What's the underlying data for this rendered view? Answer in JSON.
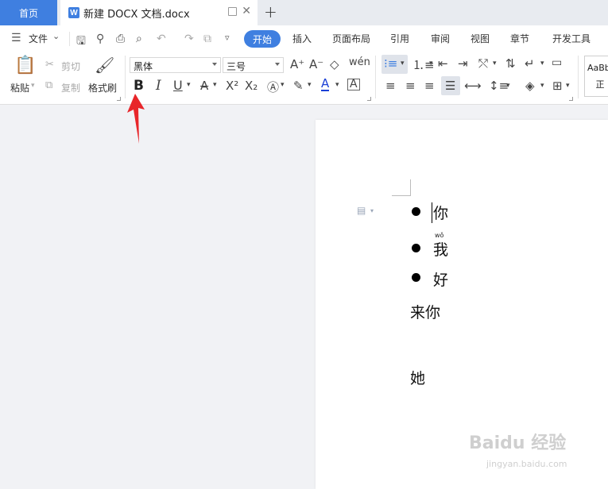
{
  "tabs": {
    "home": "首页",
    "document": "新建 DOCX 文档.docx",
    "add_icon": "+"
  },
  "menu": {
    "file": "文件",
    "items": [
      "开始",
      "插入",
      "页面布局",
      "引用",
      "审阅",
      "视图",
      "章节",
      "开发工具"
    ]
  },
  "ribbon": {
    "paste": "粘贴",
    "cut": "剪切",
    "copy": "复制",
    "format_painter": "格式刷",
    "font_name": "黑体",
    "font_size": "三号",
    "bold": "B",
    "italic": "I",
    "underline": "U",
    "styles_preview": "AaBb",
    "styles_preview_2": "正"
  },
  "document": {
    "bullets": [
      "你",
      "我",
      "好"
    ],
    "ruby_wo": "wǒ",
    "line_plain": "来你",
    "line_last": "她"
  },
  "watermark": {
    "brand": "Baidu 经验",
    "url": "jingyan.baidu.com"
  },
  "colors": {
    "accent": "#3f7fe0",
    "arrow": "#e8262a"
  }
}
